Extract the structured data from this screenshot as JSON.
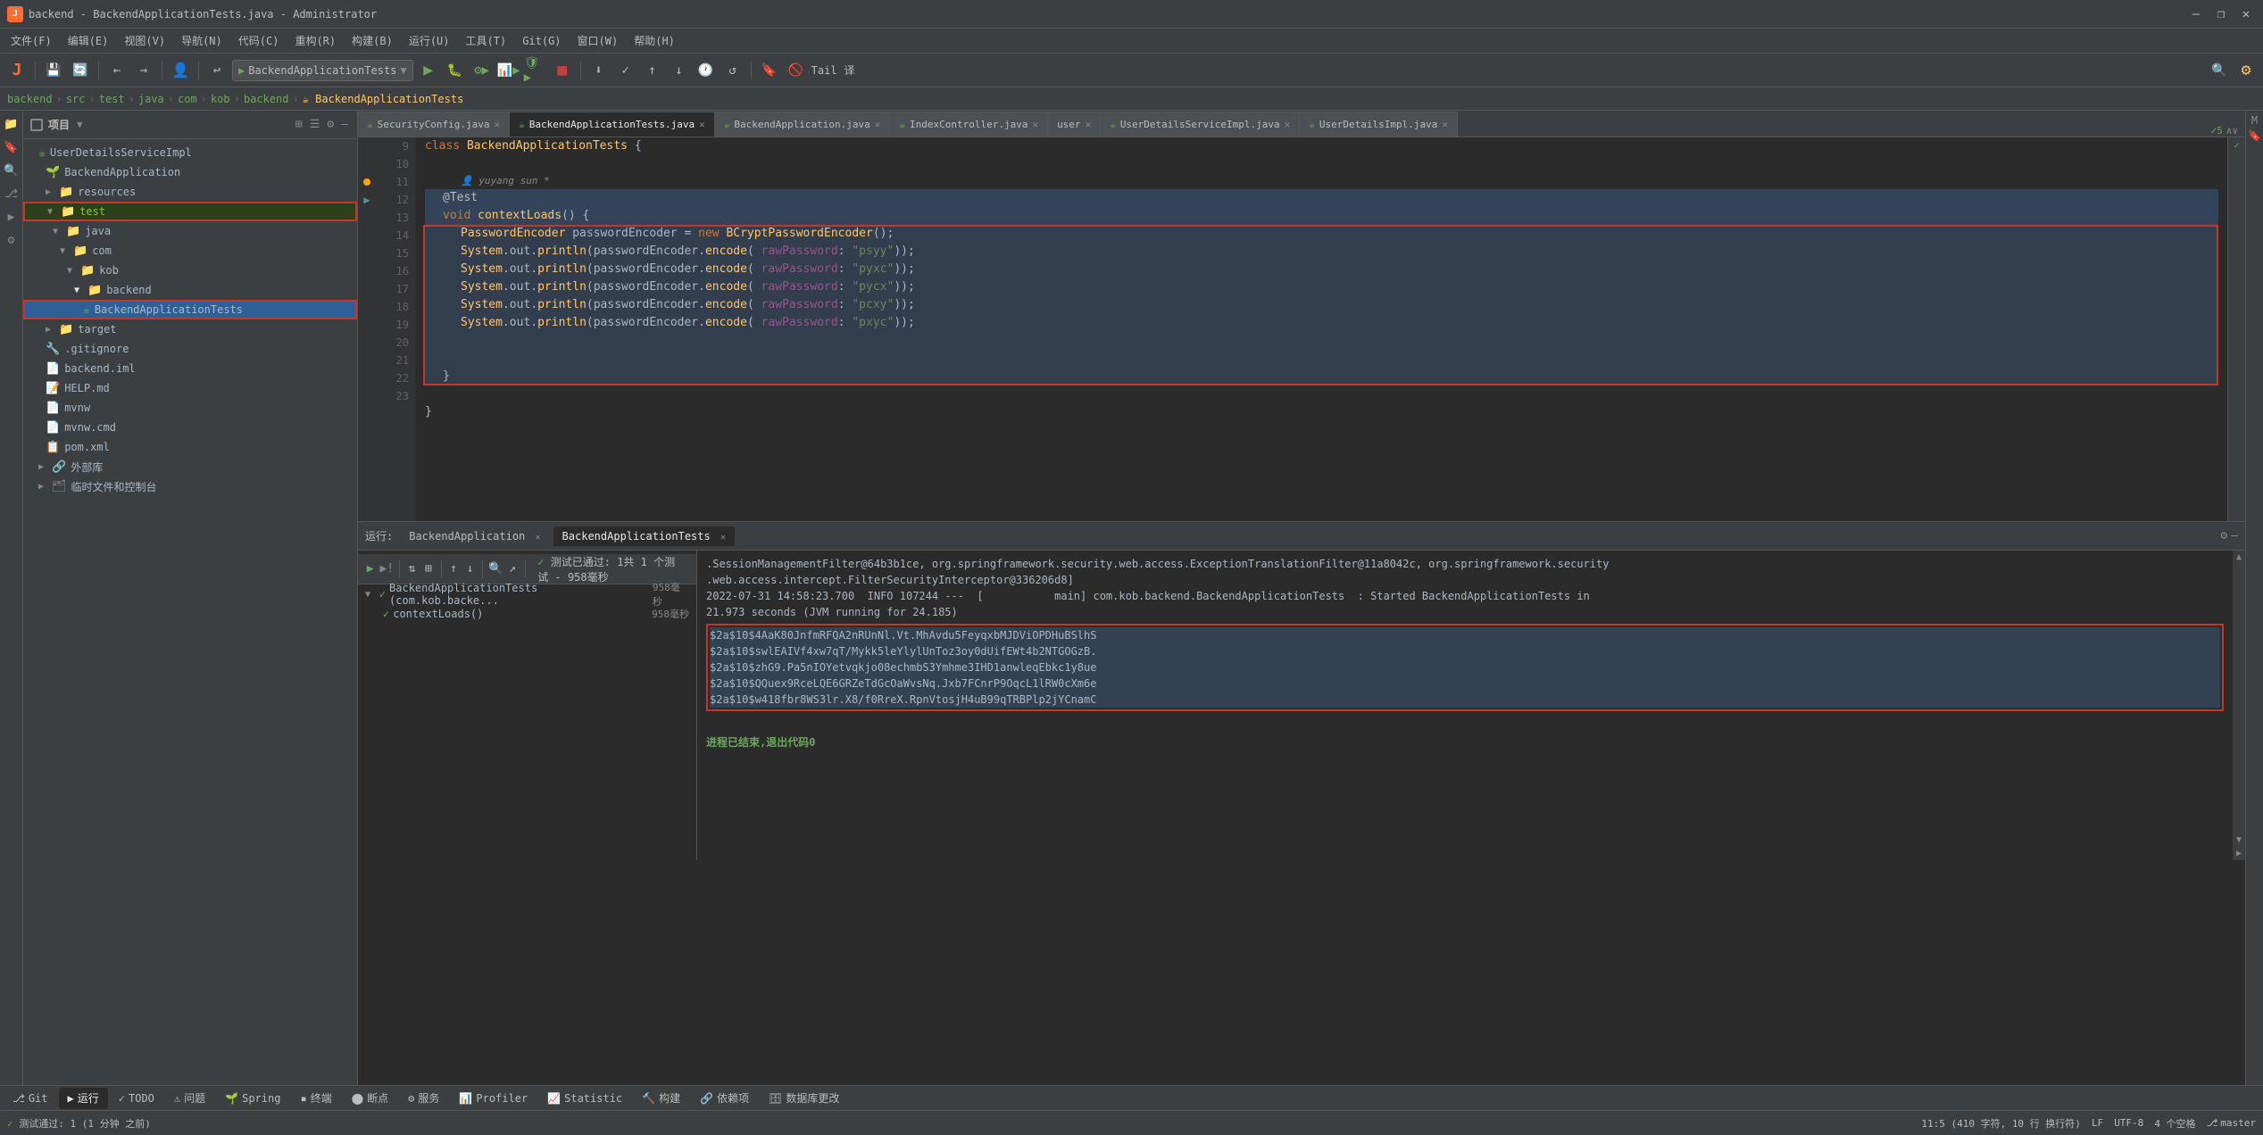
{
  "window": {
    "title": "backend - BackendApplicationTests.java - Administrator",
    "controls": [
      "—",
      "❐",
      "✕"
    ]
  },
  "menu": {
    "items": [
      "文件(F)",
      "编辑(E)",
      "视图(V)",
      "导航(N)",
      "代码(C)",
      "重构(R)",
      "构建(B)",
      "运行(U)",
      "工具(T)",
      "Git(G)",
      "窗口(W)",
      "帮助(H)"
    ]
  },
  "toolbar": {
    "app_icon": "▶",
    "run_config": "BackendApplicationTests",
    "git_label": "Git(G):",
    "tail_label": "Tail",
    "translate_label": "译"
  },
  "breadcrumb": {
    "items": [
      "backend",
      "src",
      "test",
      "java",
      "com",
      "kob",
      "backend",
      "BackendApplicationTests"
    ]
  },
  "sidebar": {
    "title": "项目",
    "tree": [
      {
        "label": "UserDetailsServiceImpl",
        "indent": 0,
        "type": "java",
        "icon": "☕"
      },
      {
        "label": "BackendApplication",
        "indent": 1,
        "type": "java",
        "icon": "☕"
      },
      {
        "label": "resources",
        "indent": 1,
        "type": "folder",
        "arrow": "▶"
      },
      {
        "label": "test",
        "indent": 1,
        "type": "folder-open",
        "arrow": "▼",
        "highlight": true
      },
      {
        "label": "java",
        "indent": 2,
        "type": "folder-open",
        "arrow": "▼"
      },
      {
        "label": "com",
        "indent": 3,
        "type": "folder-open",
        "arrow": "▼"
      },
      {
        "label": "kob",
        "indent": 4,
        "type": "folder-open",
        "arrow": "▼"
      },
      {
        "label": "backend",
        "indent": 5,
        "type": "folder-open",
        "arrow": "▼"
      },
      {
        "label": "BackendApplicationTests",
        "indent": 6,
        "type": "java",
        "icon": "☕",
        "selected": true
      },
      {
        "label": "target",
        "indent": 1,
        "type": "folder",
        "arrow": "▶"
      },
      {
        "label": ".gitignore",
        "indent": 1,
        "type": "file"
      },
      {
        "label": "backend.iml",
        "indent": 1,
        "type": "file"
      },
      {
        "label": "HELP.md",
        "indent": 1,
        "type": "file"
      },
      {
        "label": "mvnw",
        "indent": 1,
        "type": "file"
      },
      {
        "label": "mvnw.cmd",
        "indent": 1,
        "type": "file"
      },
      {
        "label": "pom.xml",
        "indent": 1,
        "type": "file"
      },
      {
        "label": "外部库",
        "indent": 0,
        "type": "folder",
        "arrow": "▶"
      },
      {
        "label": "临时文件和控制台",
        "indent": 0,
        "type": "folder",
        "arrow": "▶"
      }
    ]
  },
  "editor_tabs": [
    {
      "label": "SecurityConfig.java",
      "active": false,
      "modified": false
    },
    {
      "label": "BackendApplicationTests.java",
      "active": true,
      "modified": false
    },
    {
      "label": "BackendApplication.java",
      "active": false,
      "modified": false
    },
    {
      "label": "IndexController.java",
      "active": false,
      "modified": false
    },
    {
      "label": "user",
      "active": false,
      "modified": false
    },
    {
      "label": "UserDetailsServiceImpl.java",
      "active": false,
      "modified": false
    },
    {
      "label": "UserDetailsImpl.java",
      "active": false,
      "modified": false
    }
  ],
  "code": {
    "filename": "BackendApplicationTests.java",
    "lines": [
      {
        "num": 9,
        "content": "class BackendApplicationTests {",
        "type": "normal"
      },
      {
        "num": 10,
        "content": "",
        "type": "normal"
      },
      {
        "num": 11,
        "content": "    @Test",
        "type": "highlighted",
        "has_dot": true
      },
      {
        "num": 12,
        "content": "    void contextLoads() {",
        "type": "highlighted",
        "has_arrow": true
      },
      {
        "num": 13,
        "content": "        PasswordEncoder passwordEncoder = new BCryptPasswordEncoder();",
        "type": "selected"
      },
      {
        "num": 14,
        "content": "        System.out.println(passwordEncoder.encode( rawPassword: \"psyy\"));",
        "type": "selected"
      },
      {
        "num": 15,
        "content": "        System.out.println(passwordEncoder.encode( rawPassword: \"pyxc\"));",
        "type": "selected"
      },
      {
        "num": 16,
        "content": "        System.out.println(passwordEncoder.encode( rawPassword: \"pycx\"));",
        "type": "selected"
      },
      {
        "num": 17,
        "content": "        System.out.println(passwordEncoder.encode( rawPassword: \"pcxy\"));",
        "type": "selected"
      },
      {
        "num": 18,
        "content": "        System.out.println(passwordEncoder.encode( rawPassword: \"pxyc\"));",
        "type": "selected"
      },
      {
        "num": 19,
        "content": "",
        "type": "selected"
      },
      {
        "num": 20,
        "content": "",
        "type": "selected"
      },
      {
        "num": 21,
        "content": "    }",
        "type": "selected"
      },
      {
        "num": 22,
        "content": "",
        "type": "normal"
      },
      {
        "num": 23,
        "content": "}",
        "type": "normal"
      }
    ],
    "author_annotation": "yuyang sun *"
  },
  "run_panel": {
    "tabs": [
      "运行: BackendApplication ✕",
      "BackendApplicationTests ✕"
    ],
    "active_tab": "BackendApplicationTests",
    "test_summary": "✓ 测试已通过: 1共 1 个测试 - 958毫秒",
    "tree": [
      {
        "label": "BackendApplicationTests (com.kob.backe...",
        "time": "958毫秒",
        "indent": 0,
        "pass": true
      },
      {
        "label": "contextLoads()",
        "time": "958毫秒",
        "indent": 1,
        "pass": true
      }
    ],
    "output_lines": [
      ".SessionManagementFilter@64b3b1ce, org.springframework.security.web.access.ExceptionTranslationFilter@11a8042c, org.springframework.security",
      ".web.access.intercept.FilterSecurityInterceptor@336206d8]",
      "2022-07-31 14:58:23.700  INFO 107244 ---  [           main] com.kob.backend.BackendApplicationTests  : Started BackendApplicationTests in",
      "21.973 seconds (JVM running for 24.185)",
      "$2a$10$4AaK80JnfmRFQA2nRUnNl.Vt.MhAvdu5FeyqxbMJDViOPDHuBSlhS",
      "$2a$10$swlEAIVf4xw7qT/Mykk5leYlylUnToz3oy0dUifEWt4b2NTGOGzB.",
      "$2a$10$zhG9.Pa5nIOYetvqkjo08echmbS3Ymhme3IHD1anwleqEbkc1y8ue",
      "$2a$10$QQuex9RceLQE6GRZeTdGcOaWvsNq.Jxb7FCnrP9OqcL1lRW0cXm6e",
      "$2a$10$w418fbr8WS3lr.X8/f0RreX.RpnVtosjH4uB99qTRBPlp2jYCnamC",
      "",
      "进程已结束,退出代码0"
    ],
    "highlighted_hashes": [
      "$2a$10$4AaK80JnfmRFQA2nRUnNl.Vt.MhAvdu5FeyqxbMJDViOPDHuBSlhS",
      "$2a$10$swlEAIVf4xw7qT/Mykk5leYlylUnToz3oy0dUifEWt4b2NTGOGzB.",
      "$2a$10$zhG9.Pa5nIOYetvqkjo08echmbS3Ymhme3IHD1anwleqEbkc1y8ue",
      "$2a$10$QQuex9RceLQE6GRZeTdGcOaWvsNq.Jxb7FCnrP9OqcL1lRW0cXm6e",
      "$2a$10$w418fbr8WS3lr.X8/f0RreX.RpnVtosjH4uB99qTRBPlp2jYCnamC"
    ]
  },
  "bottom_tabs": [
    {
      "label": "Git",
      "icon": "⎇",
      "active": false
    },
    {
      "label": "运行",
      "icon": "▶",
      "active": true
    },
    {
      "label": "TODO",
      "icon": "✓",
      "active": false
    },
    {
      "label": "问题",
      "icon": "⚠",
      "active": false
    },
    {
      "label": "Spring",
      "icon": "🌱",
      "active": false
    },
    {
      "label": "终端",
      "icon": "▪",
      "active": false
    },
    {
      "label": "断点",
      "icon": "⬤",
      "active": false
    },
    {
      "label": "服务",
      "icon": "⚙",
      "active": false
    },
    {
      "label": "Profiler",
      "icon": "📊",
      "active": false
    },
    {
      "label": "Statistic",
      "icon": "📈",
      "active": false
    },
    {
      "label": "构建",
      "icon": "🔨",
      "active": false
    },
    {
      "label": "依赖项",
      "icon": "🔗",
      "active": false
    },
    {
      "label": "数据库更改",
      "icon": "🗄",
      "active": false
    }
  ],
  "status_bar": {
    "left": [
      "测试通过: 1 (1 分钟 之前)"
    ],
    "right": [
      "11:5 (410 字符, 10 行 换行符)",
      "LF",
      "UTF-8",
      "4 个空格",
      "master"
    ]
  }
}
